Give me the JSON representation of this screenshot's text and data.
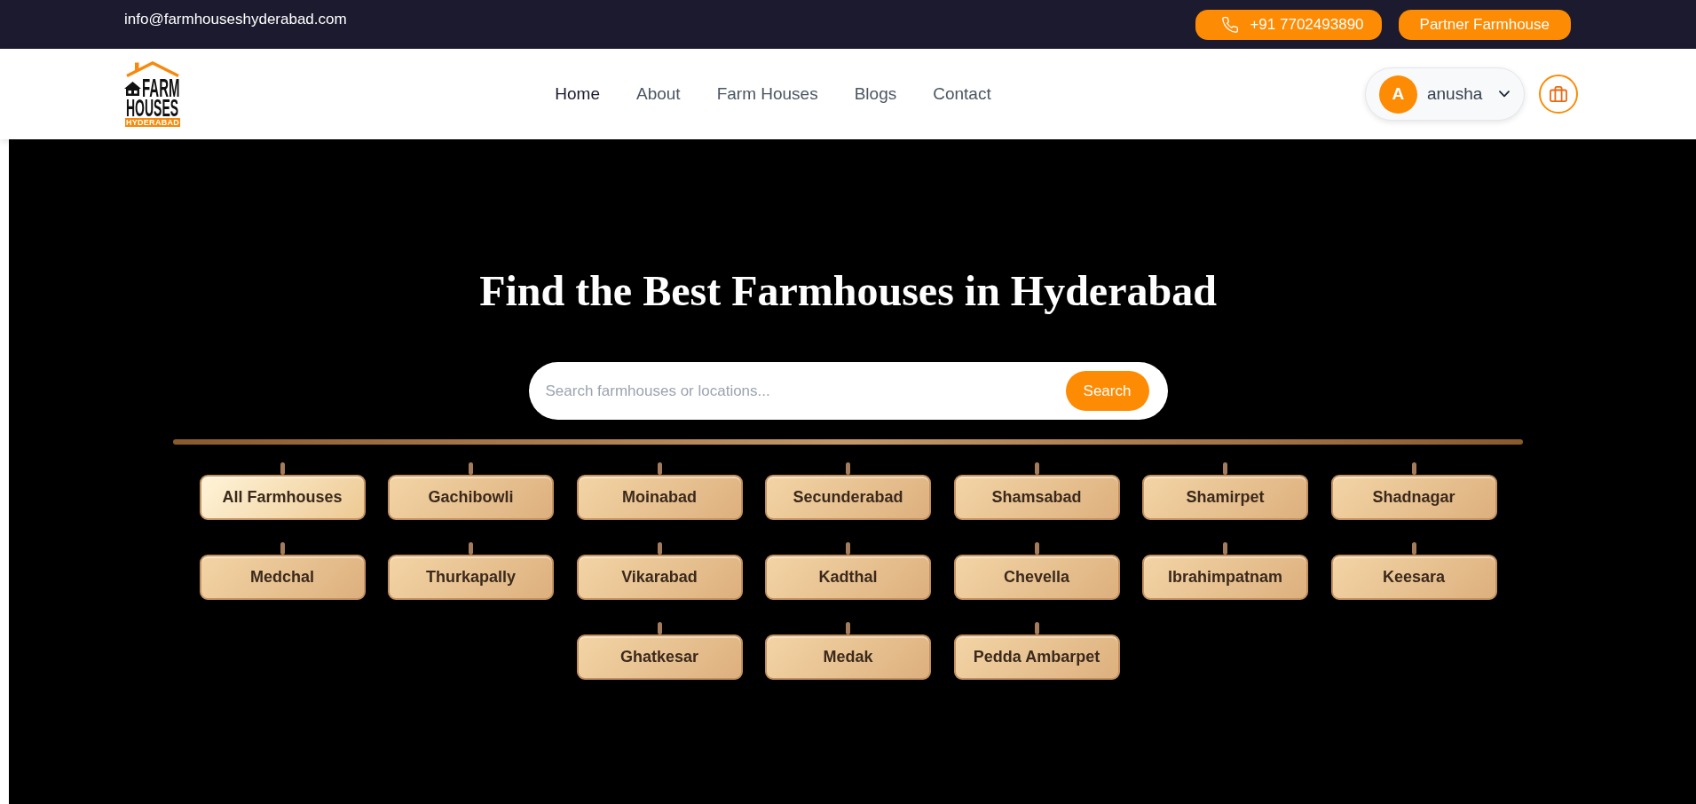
{
  "top_bar": {
    "email": "info@farmhouseshyderabad.com",
    "phone": "+91 7702493890",
    "partner_button": "Partner Farmhouse"
  },
  "header": {
    "logo": {
      "line_1": "FARM",
      "line_2": "HOUSES",
      "tagline": "HYDERABAD"
    },
    "nav": [
      {
        "label": "Home",
        "selected": true
      },
      {
        "label": "About",
        "selected": false
      },
      {
        "label": "Farm Houses",
        "selected": false
      },
      {
        "label": "Blogs",
        "selected": false
      },
      {
        "label": "Contact",
        "selected": false
      }
    ],
    "user": {
      "initial": "A",
      "name": "anusha"
    }
  },
  "hero": {
    "title": "Find the Best Farmhouses in Hyderabad",
    "search": {
      "placeholder": "Search farmhouses or locations...",
      "button": "Search"
    },
    "locations": [
      {
        "label": "All Farmhouses",
        "selected": true
      },
      {
        "label": "Gachibowli",
        "selected": false
      },
      {
        "label": "Moinabad",
        "selected": false
      },
      {
        "label": "Secunderabad",
        "selected": false
      },
      {
        "label": "Shamsabad",
        "selected": false
      },
      {
        "label": "Shamirpet",
        "selected": false
      },
      {
        "label": "Shadnagar",
        "selected": false
      },
      {
        "label": "Medchal",
        "selected": false
      },
      {
        "label": "Thurkapally",
        "selected": false
      },
      {
        "label": "Vikarabad",
        "selected": false
      },
      {
        "label": "Kadthal",
        "selected": false
      },
      {
        "label": "Chevella",
        "selected": false
      },
      {
        "label": "Ibrahimpatnam",
        "selected": false
      },
      {
        "label": "Keesara",
        "selected": false
      },
      {
        "label": "Ghatkesar",
        "selected": false
      },
      {
        "label": "Medak",
        "selected": false
      },
      {
        "label": "Pedda Ambarpet",
        "selected": false
      }
    ]
  }
}
